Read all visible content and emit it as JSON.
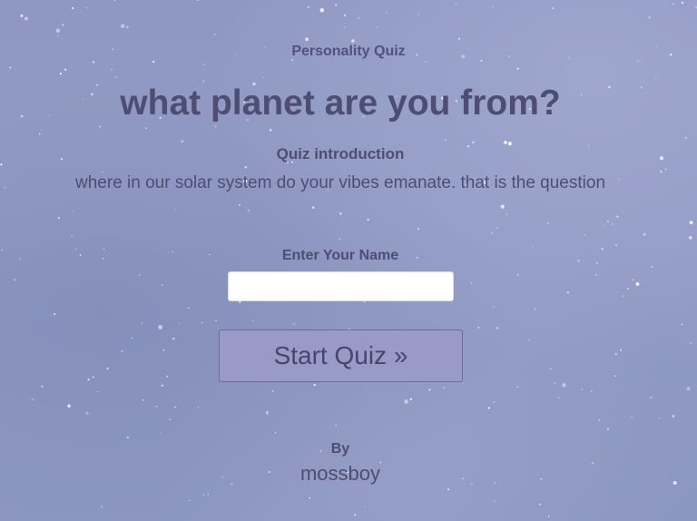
{
  "quiz": {
    "type": "Personality Quiz",
    "title": "what planet are you from?",
    "intro_heading": "Quiz introduction",
    "intro_text": "where in our solar system do your vibes emanate. that is the question"
  },
  "form": {
    "name_label": "Enter Your Name",
    "name_value": "",
    "name_placeholder": "",
    "start_button_label": "Start Quiz »"
  },
  "credits": {
    "by_label": "By",
    "author": "mossboy"
  },
  "theme": {
    "background": "#8f99c2",
    "text": "#4f4d72",
    "button_bg": "#9a9ac8",
    "input_bg": "#ffffff"
  }
}
